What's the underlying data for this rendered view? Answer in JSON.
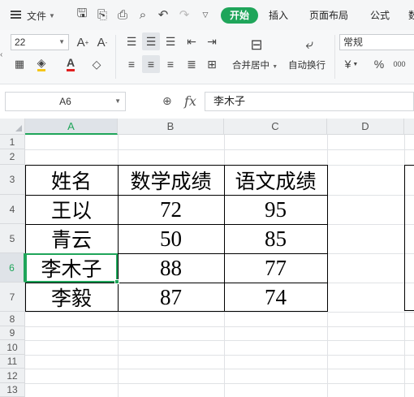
{
  "menubar": {
    "file_label": "文件",
    "tabs": [
      {
        "label": "开始",
        "active": true
      },
      {
        "label": "插入",
        "active": false
      },
      {
        "label": "页面布局",
        "active": false
      },
      {
        "label": "公式",
        "active": false
      },
      {
        "label": "数",
        "active": false
      }
    ]
  },
  "ribbon": {
    "font_size": "22",
    "merge_label": "合并居中",
    "wrap_label": "自动换行",
    "number_format": "常规",
    "currency_symbol": "¥",
    "percent_symbol": "%",
    "thousands_symbol": "000",
    "font_color": "#e02020",
    "fill_color": "#f5c518"
  },
  "formula": {
    "cell_ref": "A6",
    "fx_label": "fx",
    "content": "李木子"
  },
  "grid": {
    "columns": [
      "A",
      "B",
      "C",
      "D"
    ],
    "active_column": "A",
    "rows": [
      "1",
      "2",
      "3",
      "4",
      "5",
      "6",
      "7",
      "8",
      "9",
      "10",
      "11",
      "12",
      "13"
    ],
    "active_row": "6",
    "accent_color": "#1fa55a"
  },
  "table": {
    "header": [
      "姓名",
      "数学成绩",
      "语文成绩"
    ],
    "rows": [
      [
        "王以",
        "72",
        "95"
      ],
      [
        "青云",
        "50",
        "85"
      ],
      [
        "李木子",
        "88",
        "77"
      ],
      [
        "李毅",
        "87",
        "74"
      ]
    ]
  }
}
